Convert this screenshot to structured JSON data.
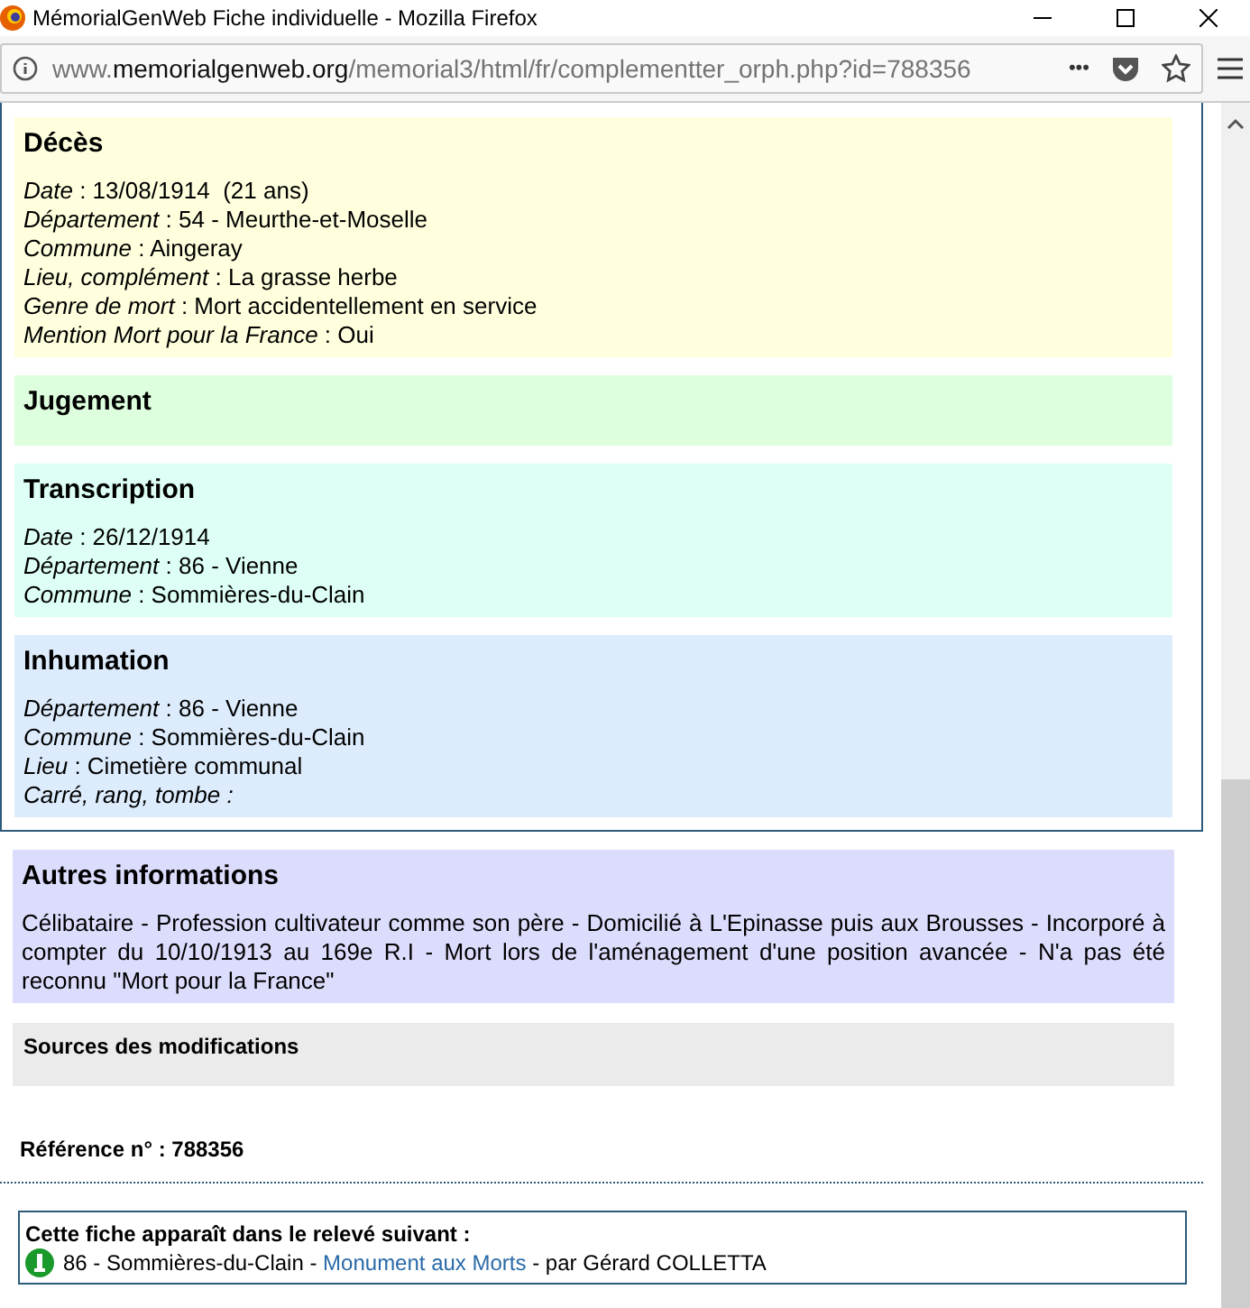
{
  "window": {
    "title": "MémorialGenWeb Fiche individuelle - Mozilla Firefox"
  },
  "address_bar": {
    "prefix": "www.",
    "domain": "memorialgenweb.org",
    "path": "/memorial3/html/fr/complementter_orph.php?id=788356",
    "more": "•••"
  },
  "sections": [
    {
      "title": "Décès",
      "color": "#ffffdd",
      "fields": [
        "*Date* : 13/08/1914  (21 ans)",
        "*Département* : 54 - Meurthe-et-Moselle",
        "*Commune* : Aingeray",
        "*Lieu, complément* : La grasse herbe",
        "*Genre de mort* : Mort accidentellement en service",
        "*Mention Mort pour la France* : Oui"
      ]
    },
    {
      "title": "Jugement",
      "color": "#ddffdd"
    },
    {
      "title": "Transcription",
      "color": "#ddfff5",
      "fields": [
        "*Date* : 26/12/1914",
        "*Département* : 86 - Vienne",
        "*Commune* : Sommières-du-Clain"
      ]
    },
    {
      "title": "Inhumation",
      "color": "#ddecfd",
      "fields": [
        "*Département* : 86 - Vienne",
        "*Commune* : Sommières-du-Clain",
        "*Lieu* : Cimetière communal",
        "*Carré, rang, tombe :*"
      ]
    }
  ],
  "other_info": {
    "title": "Autres informations",
    "text": "Célibataire - Profession cultivateur comme son père - Domicilié à L'Epinasse puis aux Brousses - Incorporé à compter du 10/10/1913 au 169e R.I - Mort lors de l'aménagement d'une position avancée - N'a pas été reconnu \"Mort pour la France\""
  },
  "sources": {
    "title": "Sources des modifications"
  },
  "reference": "Référence n° : 788356",
  "survey": {
    "title": "Cette fiche apparaît dans le relevé suivant :",
    "before": "86 - Sommières-du-Clain - ",
    "link": "Monument aux Morts",
    "after": " - par Gérard COLLETTA"
  }
}
